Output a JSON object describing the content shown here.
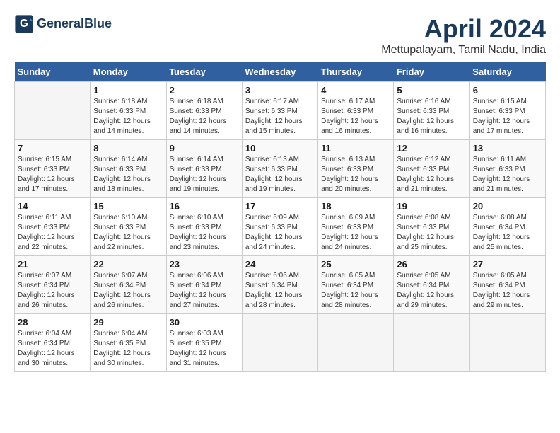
{
  "header": {
    "logo_line1": "General",
    "logo_line2": "Blue",
    "title": "April 2024",
    "subtitle": "Mettupalayam, Tamil Nadu, India"
  },
  "days_of_week": [
    "Sunday",
    "Monday",
    "Tuesday",
    "Wednesday",
    "Thursday",
    "Friday",
    "Saturday"
  ],
  "weeks": [
    [
      {
        "day": "",
        "info": ""
      },
      {
        "day": "1",
        "info": "Sunrise: 6:18 AM\nSunset: 6:33 PM\nDaylight: 12 hours\nand 14 minutes."
      },
      {
        "day": "2",
        "info": "Sunrise: 6:18 AM\nSunset: 6:33 PM\nDaylight: 12 hours\nand 14 minutes."
      },
      {
        "day": "3",
        "info": "Sunrise: 6:17 AM\nSunset: 6:33 PM\nDaylight: 12 hours\nand 15 minutes."
      },
      {
        "day": "4",
        "info": "Sunrise: 6:17 AM\nSunset: 6:33 PM\nDaylight: 12 hours\nand 16 minutes."
      },
      {
        "day": "5",
        "info": "Sunrise: 6:16 AM\nSunset: 6:33 PM\nDaylight: 12 hours\nand 16 minutes."
      },
      {
        "day": "6",
        "info": "Sunrise: 6:15 AM\nSunset: 6:33 PM\nDaylight: 12 hours\nand 17 minutes."
      }
    ],
    [
      {
        "day": "7",
        "info": "Sunrise: 6:15 AM\nSunset: 6:33 PM\nDaylight: 12 hours\nand 17 minutes."
      },
      {
        "day": "8",
        "info": "Sunrise: 6:14 AM\nSunset: 6:33 PM\nDaylight: 12 hours\nand 18 minutes."
      },
      {
        "day": "9",
        "info": "Sunrise: 6:14 AM\nSunset: 6:33 PM\nDaylight: 12 hours\nand 19 minutes."
      },
      {
        "day": "10",
        "info": "Sunrise: 6:13 AM\nSunset: 6:33 PM\nDaylight: 12 hours\nand 19 minutes."
      },
      {
        "day": "11",
        "info": "Sunrise: 6:13 AM\nSunset: 6:33 PM\nDaylight: 12 hours\nand 20 minutes."
      },
      {
        "day": "12",
        "info": "Sunrise: 6:12 AM\nSunset: 6:33 PM\nDaylight: 12 hours\nand 21 minutes."
      },
      {
        "day": "13",
        "info": "Sunrise: 6:11 AM\nSunset: 6:33 PM\nDaylight: 12 hours\nand 21 minutes."
      }
    ],
    [
      {
        "day": "14",
        "info": "Sunrise: 6:11 AM\nSunset: 6:33 PM\nDaylight: 12 hours\nand 22 minutes."
      },
      {
        "day": "15",
        "info": "Sunrise: 6:10 AM\nSunset: 6:33 PM\nDaylight: 12 hours\nand 22 minutes."
      },
      {
        "day": "16",
        "info": "Sunrise: 6:10 AM\nSunset: 6:33 PM\nDaylight: 12 hours\nand 23 minutes."
      },
      {
        "day": "17",
        "info": "Sunrise: 6:09 AM\nSunset: 6:33 PM\nDaylight: 12 hours\nand 24 minutes."
      },
      {
        "day": "18",
        "info": "Sunrise: 6:09 AM\nSunset: 6:33 PM\nDaylight: 12 hours\nand 24 minutes."
      },
      {
        "day": "19",
        "info": "Sunrise: 6:08 AM\nSunset: 6:33 PM\nDaylight: 12 hours\nand 25 minutes."
      },
      {
        "day": "20",
        "info": "Sunrise: 6:08 AM\nSunset: 6:34 PM\nDaylight: 12 hours\nand 25 minutes."
      }
    ],
    [
      {
        "day": "21",
        "info": "Sunrise: 6:07 AM\nSunset: 6:34 PM\nDaylight: 12 hours\nand 26 minutes."
      },
      {
        "day": "22",
        "info": "Sunrise: 6:07 AM\nSunset: 6:34 PM\nDaylight: 12 hours\nand 26 minutes."
      },
      {
        "day": "23",
        "info": "Sunrise: 6:06 AM\nSunset: 6:34 PM\nDaylight: 12 hours\nand 27 minutes."
      },
      {
        "day": "24",
        "info": "Sunrise: 6:06 AM\nSunset: 6:34 PM\nDaylight: 12 hours\nand 28 minutes."
      },
      {
        "day": "25",
        "info": "Sunrise: 6:05 AM\nSunset: 6:34 PM\nDaylight: 12 hours\nand 28 minutes."
      },
      {
        "day": "26",
        "info": "Sunrise: 6:05 AM\nSunset: 6:34 PM\nDaylight: 12 hours\nand 29 minutes."
      },
      {
        "day": "27",
        "info": "Sunrise: 6:05 AM\nSunset: 6:34 PM\nDaylight: 12 hours\nand 29 minutes."
      }
    ],
    [
      {
        "day": "28",
        "info": "Sunrise: 6:04 AM\nSunset: 6:34 PM\nDaylight: 12 hours\nand 30 minutes."
      },
      {
        "day": "29",
        "info": "Sunrise: 6:04 AM\nSunset: 6:35 PM\nDaylight: 12 hours\nand 30 minutes."
      },
      {
        "day": "30",
        "info": "Sunrise: 6:03 AM\nSunset: 6:35 PM\nDaylight: 12 hours\nand 31 minutes."
      },
      {
        "day": "",
        "info": ""
      },
      {
        "day": "",
        "info": ""
      },
      {
        "day": "",
        "info": ""
      },
      {
        "day": "",
        "info": ""
      }
    ]
  ]
}
